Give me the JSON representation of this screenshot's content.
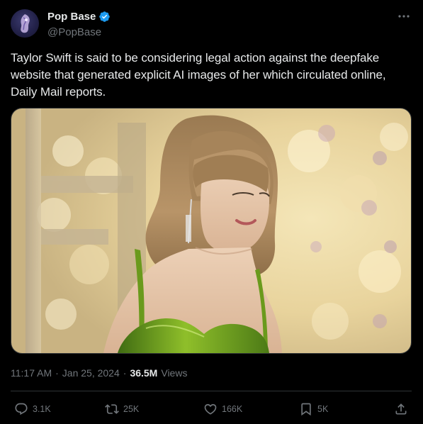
{
  "author": {
    "display_name": "Pop Base",
    "handle": "@PopBase",
    "verified_color": "#1d9bf0"
  },
  "tweet": {
    "text": "Taylor Swift is said to be considering legal action against the deepfake website that generated explicit AI images of her which circulated online, Daily Mail reports.",
    "time": "11:17 AM",
    "separator": "·",
    "date": "Jan 25, 2024",
    "separator2": "·",
    "views_count": "36.5M",
    "views_label": "Views"
  },
  "actions": {
    "reply_count": "3.1K",
    "retweet_count": "25K",
    "like_count": "166K",
    "bookmark_count": "5K"
  },
  "icons": {
    "more": "more-horizontal-icon",
    "verified": "verified-badge-icon",
    "reply": "reply-icon",
    "retweet": "retweet-icon",
    "like": "heart-icon",
    "bookmark": "bookmark-icon",
    "share": "share-icon"
  },
  "colors": {
    "background": "#000000",
    "text_primary": "#e7e9ea",
    "text_secondary": "#71767b",
    "divider": "#2f3336",
    "accent": "#1d9bf0"
  }
}
